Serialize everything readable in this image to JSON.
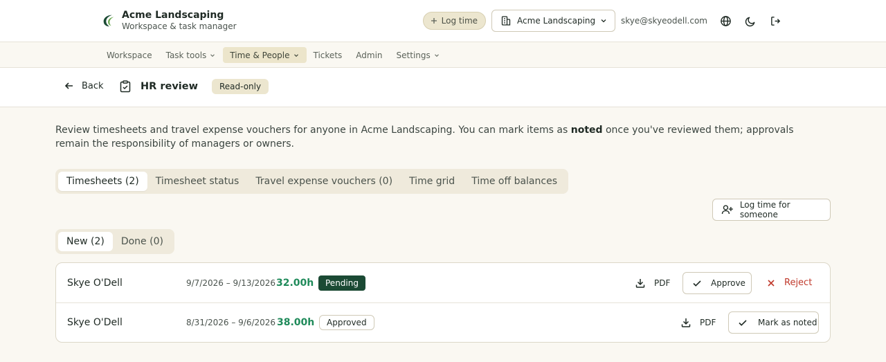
{
  "brand": {
    "title": "Acme Landscaping",
    "subtitle": "Workspace & task manager"
  },
  "header": {
    "log_time_label": "Log time",
    "org_select_value": "Acme Landscaping",
    "email": "skye@skyeodell.com"
  },
  "nav": {
    "items": [
      {
        "label": "Workspace",
        "has_menu": false,
        "active": false
      },
      {
        "label": "Task tools",
        "has_menu": true,
        "active": false
      },
      {
        "label": "Time & People",
        "has_menu": true,
        "active": true
      },
      {
        "label": "Tickets",
        "has_menu": false,
        "active": false
      },
      {
        "label": "Admin",
        "has_menu": false,
        "active": false
      },
      {
        "label": "Settings",
        "has_menu": true,
        "active": false
      }
    ]
  },
  "subheader": {
    "back_label": "Back",
    "title": "HR review",
    "badge": "Read-only"
  },
  "intro": {
    "before": "Review timesheets and travel expense vouchers for anyone in Acme Landscaping. You can mark items as ",
    "emphasis": "noted",
    "after": " once you've reviewed them; approvals remain the responsibility of managers or owners."
  },
  "tabs": [
    {
      "label": "Timesheets (2)",
      "active": true
    },
    {
      "label": "Timesheet status",
      "active": false
    },
    {
      "label": "Travel expense vouchers (0)",
      "active": false
    },
    {
      "label": "Time grid",
      "active": false
    },
    {
      "label": "Time off balances",
      "active": false
    }
  ],
  "log_for_someone_label": "Log time for someone",
  "subtabs": [
    {
      "label": "New (2)",
      "active": true
    },
    {
      "label": "Done (0)",
      "active": false
    }
  ],
  "timesheets": [
    {
      "name": "Skye O'Dell",
      "range": "9/7/2026 – 9/13/2026",
      "hours": "32.00h",
      "status": "Pending",
      "pdf": "PDF",
      "primary_action": "Approve",
      "secondary_action": "Reject"
    },
    {
      "name": "Skye O'Dell",
      "range": "8/31/2026 – 9/6/2026",
      "hours": "38.00h",
      "status": "Approved",
      "pdf": "PDF",
      "primary_action": "Mark as noted"
    }
  ],
  "colors": {
    "accent_green": "#1f8a5a",
    "pending_bg": "#1b4a34",
    "reject_red": "#c0392b",
    "badge_bg": "#ece6cf"
  },
  "icons": [
    "brand-logo-icon",
    "plus-icon",
    "building-icon",
    "chevron-down-icon",
    "globe-icon",
    "moon-icon",
    "logout-icon",
    "arrow-left-icon",
    "clipboard-check-icon",
    "user-plus-icon",
    "download-icon",
    "check-icon",
    "close-icon"
  ]
}
